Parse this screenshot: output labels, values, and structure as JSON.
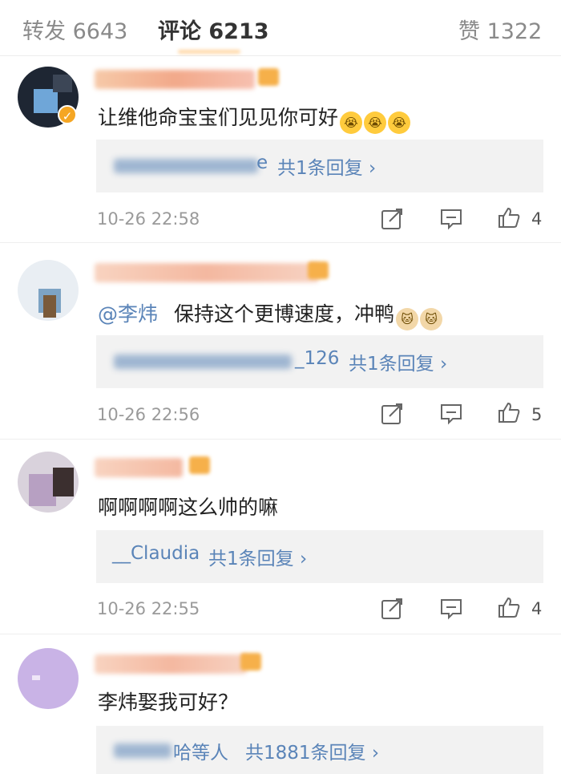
{
  "tabs": {
    "repost": "转发 6643",
    "comments": "评论 6213",
    "likes": "赞 1322"
  },
  "comments": [
    {
      "text": "让维他命宝宝们见见你可好",
      "reply_tail": "e",
      "reply_count": "共1条回复",
      "time": "10-26 22:58",
      "likes": "4"
    },
    {
      "mention": "@李炜",
      "text": "保持这个更博速度，冲鸭",
      "reply_tail": "_126",
      "reply_count": "共1条回复",
      "time": "10-26 22:56",
      "likes": "5"
    },
    {
      "text": "啊啊啊啊这么帅的嘛",
      "reply_tail": "__Claudia",
      "reply_count": "共1条回复",
      "time": "10-26 22:55",
      "likes": "4"
    },
    {
      "text": "李炜娶我可好？",
      "reply_tail": "哈等人",
      "reply_count": "共1881条回复"
    }
  ],
  "colors": {
    "link": "#5a84b8",
    "reply_bg": "#f2f2f2",
    "time": "#9a9a9a"
  }
}
